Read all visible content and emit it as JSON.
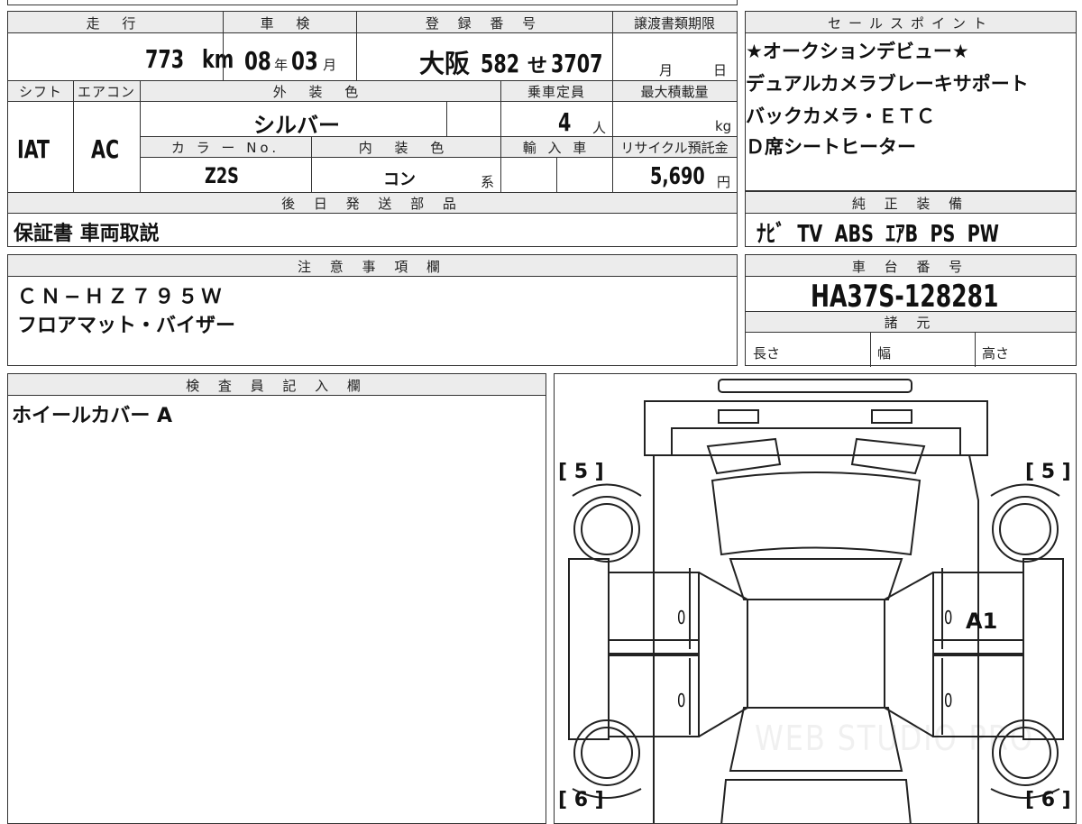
{
  "header_row": {
    "mileage_label": "走 行",
    "inspection_label": "車 検",
    "registration_label": "登 録 番 号",
    "transfer_deadline_label": "譲渡書類期限"
  },
  "mileage": {
    "value": "773",
    "unit": "km"
  },
  "inspection": {
    "year": "08",
    "year_unit": "年",
    "month": "03",
    "month_unit": "月"
  },
  "registration": {
    "region": "大阪",
    "class": "582",
    "kana": "せ",
    "number": "3707"
  },
  "transfer_deadline": {
    "month_unit": "月",
    "day_unit": "日"
  },
  "row2_labels": {
    "shift": "シフト",
    "aircon": "エアコン",
    "exterior_color": "外 装 色",
    "capacity": "乗車定員",
    "max_load": "最大積載量"
  },
  "shift": "IAT",
  "aircon": "AC",
  "exterior_color": "シルバー",
  "capacity": {
    "value": "4",
    "unit": "人"
  },
  "max_load": {
    "unit": "kg"
  },
  "row3_labels": {
    "color_no": "カ ラ ー No.",
    "interior_color": "内 装 色",
    "import": "輸 入 車",
    "recycle": "リサイクル預託金"
  },
  "color_no": "Z2S",
  "interior_color": {
    "value": "コン",
    "suffix": "系"
  },
  "recycle_fee": {
    "value": "5,690",
    "unit": "円"
  },
  "later_parts": {
    "label": "後 日 発 送 部 品",
    "value": "保証書 車両取説"
  },
  "sales_points": {
    "label": "セールスポイント",
    "lines": [
      "★オークションデビュー★",
      "デュアルカメラブレーキサポート",
      "バックカメラ・ＥＴＣ",
      "Ｄ席シートヒーター"
    ]
  },
  "equipment": {
    "label": "純 正 装 備",
    "value": "ﾅﾋﾞ  TV  ABS  ｴｱB  PS  PW"
  },
  "notes": {
    "label": "注 意 事 項 欄",
    "lines": [
      "ＣＮ−ＨＺ７９５Ｗ",
      "フロアマット・バイザー"
    ]
  },
  "chassis": {
    "label": "車 台 番 号",
    "value": "HA37S-128281"
  },
  "specs": {
    "label": "諸 元",
    "length": "長さ",
    "width": "幅",
    "height": "高さ"
  },
  "inspector": {
    "label": "検 査 員 記 入 欄",
    "value": "ホイールカバー A"
  },
  "diagram": {
    "tl": "[ 5 ]",
    "tr": "[ 5 ]",
    "bl": "[ 6 ]",
    "br": "[ 6 ]",
    "mark_front_left": "0",
    "mark_front_right": "0",
    "mark_rear_left": "0",
    "mark_rear_right": "0",
    "damage_code": "A1",
    "watermark": "WEB STUDIO PRO"
  }
}
